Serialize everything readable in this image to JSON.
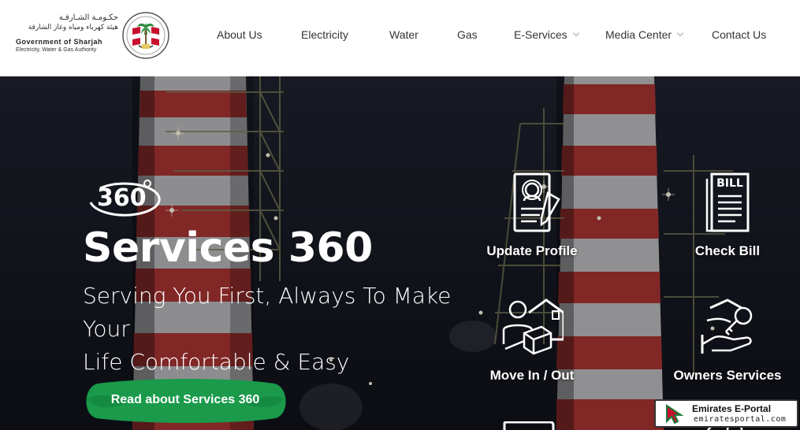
{
  "header": {
    "logo": {
      "arabic_line1": "حكـومـة الشـارقـة",
      "arabic_line2": "هيئة كهرباء ومياه وغاز الشارقة",
      "english_line1": "Government of Sharjah",
      "english_line2": "Electricity, Water & Gas Authority"
    },
    "nav": [
      {
        "label": "About Us",
        "dropdown": false
      },
      {
        "label": "Electricity",
        "dropdown": false
      },
      {
        "label": "Water",
        "dropdown": false
      },
      {
        "label": "Gas",
        "dropdown": false
      },
      {
        "label": "E-Services",
        "dropdown": true
      },
      {
        "label": "Media Center",
        "dropdown": true
      },
      {
        "label": "Contact Us",
        "dropdown": false
      }
    ]
  },
  "hero": {
    "badge_text": "360",
    "title": "Services 360",
    "subtitle_line1": "Serving You First, Always To Make Your",
    "subtitle_line2": "Life Comfortable & Easy",
    "cta_label": "Read about Services 360",
    "cta_color": "#1a9a4a",
    "services": [
      {
        "label": "Update Profile",
        "icon": "profile-document-icon"
      },
      {
        "label": "Check Bill",
        "icon": "bill-icon"
      },
      {
        "label": "Move In / Out",
        "icon": "house-box-icon"
      },
      {
        "label": "Owners Services",
        "icon": "hand-key-icon"
      }
    ]
  },
  "watermark": {
    "title": "Emirates E-Portal",
    "url": "emiratesportal.com"
  }
}
